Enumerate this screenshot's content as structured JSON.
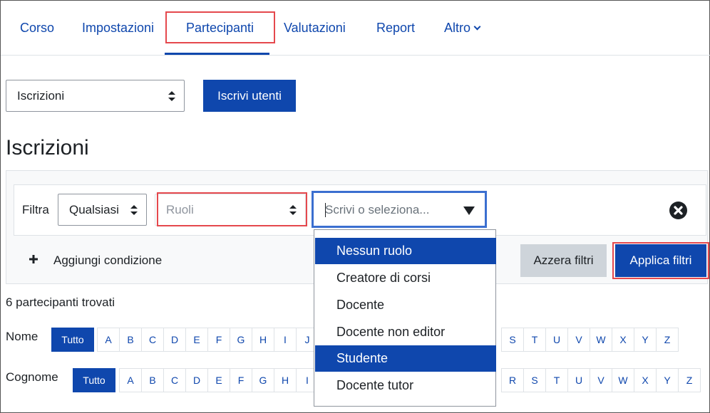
{
  "nav": {
    "tabs": [
      "Corso",
      "Impostazioni",
      "Partecipanti",
      "Valutazioni",
      "Report",
      "Altro"
    ],
    "active": "Partecipanti"
  },
  "enrol_select": {
    "value": "Iscrizioni"
  },
  "enrol_button": "Iscrivi utenti",
  "page_title": "Iscrizioni",
  "filter": {
    "label": "Filtra",
    "match_value": "Qualsiasi",
    "type_value": "Ruoli",
    "value_placeholder": "Scrivi o seleziona...",
    "add_condition": "Aggiungi condizione",
    "reset": "Azzera filtri",
    "apply": "Applica filtri"
  },
  "roles_options": [
    "Nessun ruolo",
    "Creatore di corsi",
    "Docente",
    "Docente non editor",
    "Studente",
    "Docente tutor"
  ],
  "participants_found": "6 partecipanti trovati",
  "initials": {
    "first_name_label": "Nome",
    "last_name_label": "Cognome",
    "all_label": "Tutto",
    "letters_start": [
      "A",
      "B",
      "C",
      "D",
      "E",
      "F",
      "G",
      "H",
      "I",
      "J"
    ],
    "letters_end": [
      "S",
      "T",
      "U",
      "V",
      "W",
      "X",
      "Y",
      "Z"
    ],
    "last_letters_start": [
      "A",
      "B",
      "C",
      "D",
      "E",
      "F",
      "G",
      "H",
      "I"
    ],
    "last_letters_end": [
      "R",
      "S",
      "T",
      "U",
      "V",
      "W",
      "X",
      "Y",
      "Z"
    ]
  },
  "colors": {
    "primary": "#0f47ad",
    "highlight": "#e5484d",
    "focus": "#3b6fd0"
  }
}
